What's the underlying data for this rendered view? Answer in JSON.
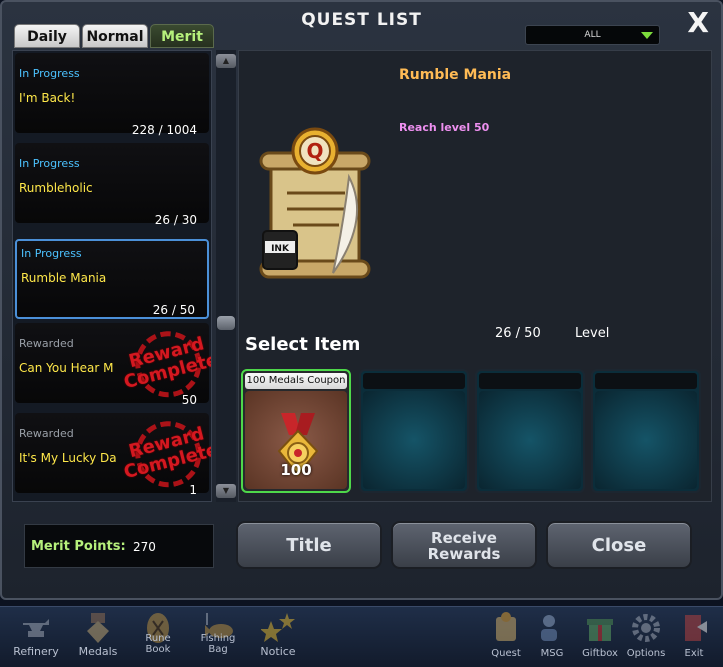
{
  "window": {
    "title": "QUEST LIST",
    "close_label": "X"
  },
  "filter": {
    "value": "ALL"
  },
  "tabs": [
    {
      "label": "Daily",
      "active": false
    },
    {
      "label": "Normal",
      "active": false
    },
    {
      "label": "Merit",
      "active": true
    }
  ],
  "quests": [
    {
      "status": "In Progress",
      "name": "I'm Back!",
      "progress": "228 / 1004",
      "rewarded": false,
      "selected": false
    },
    {
      "status": "In Progress",
      "name": "Rumbleholic",
      "progress": "26 / 30",
      "rewarded": false,
      "selected": false
    },
    {
      "status": "In Progress",
      "name": "Rumble Mania",
      "progress": "26 / 50",
      "rewarded": false,
      "selected": true
    },
    {
      "status": "Rewarded",
      "name": "Can You Hear M",
      "progress": "50",
      "rewarded": true,
      "selected": false
    },
    {
      "status": "Rewarded",
      "name": "It's My Lucky Da",
      "progress": "1",
      "rewarded": true,
      "selected": false
    }
  ],
  "stamp_text": {
    "line1": "Reward",
    "line2": "Complete"
  },
  "detail": {
    "title": "Rumble Mania",
    "description": "Reach level 50",
    "select_item_label": "Select Item",
    "progress": "26 / 50",
    "progress_unit": "Level",
    "scroll_icon_letter": "Q",
    "ink_label": "INK"
  },
  "reward_slots": [
    {
      "label": "100 Medals Coupon",
      "count": "100",
      "filled": true
    },
    {
      "label": "",
      "filled": false
    },
    {
      "label": "",
      "filled": false
    },
    {
      "label": "",
      "filled": false
    }
  ],
  "merit": {
    "label": "Merit Points:",
    "value": "270"
  },
  "buttons": {
    "title": "Title",
    "receive_line1": "Receive",
    "receive_line2": "Rewards",
    "close": "Close"
  },
  "taskbar": [
    {
      "label": "Refinery",
      "icon": "anvil-icon"
    },
    {
      "label": "Medals",
      "icon": "medal-icon"
    },
    {
      "label1": "Rune",
      "label2": "Book",
      "icon": "rune-book-icon"
    },
    {
      "label1": "Fishing",
      "label2": "Bag",
      "icon": "fishing-bag-icon"
    },
    {
      "label": "Notice",
      "icon": "stars-icon"
    },
    {
      "label": "Quest",
      "icon": "quest-scroll-icon"
    },
    {
      "label": "MSG",
      "icon": "message-icon"
    },
    {
      "label": "Giftbox",
      "icon": "giftbox-icon"
    },
    {
      "label": "Options",
      "icon": "gear-icon"
    },
    {
      "label": "Exit",
      "icon": "exit-door-icon"
    }
  ],
  "colors": {
    "accent_green": "#b6f07c",
    "status_blue": "#4cc2ff",
    "quest_name_yellow": "#ffe84a",
    "title_orange": "#ffbb55",
    "desc_pink": "#ee90f0",
    "stamp_red": "#d41820"
  }
}
